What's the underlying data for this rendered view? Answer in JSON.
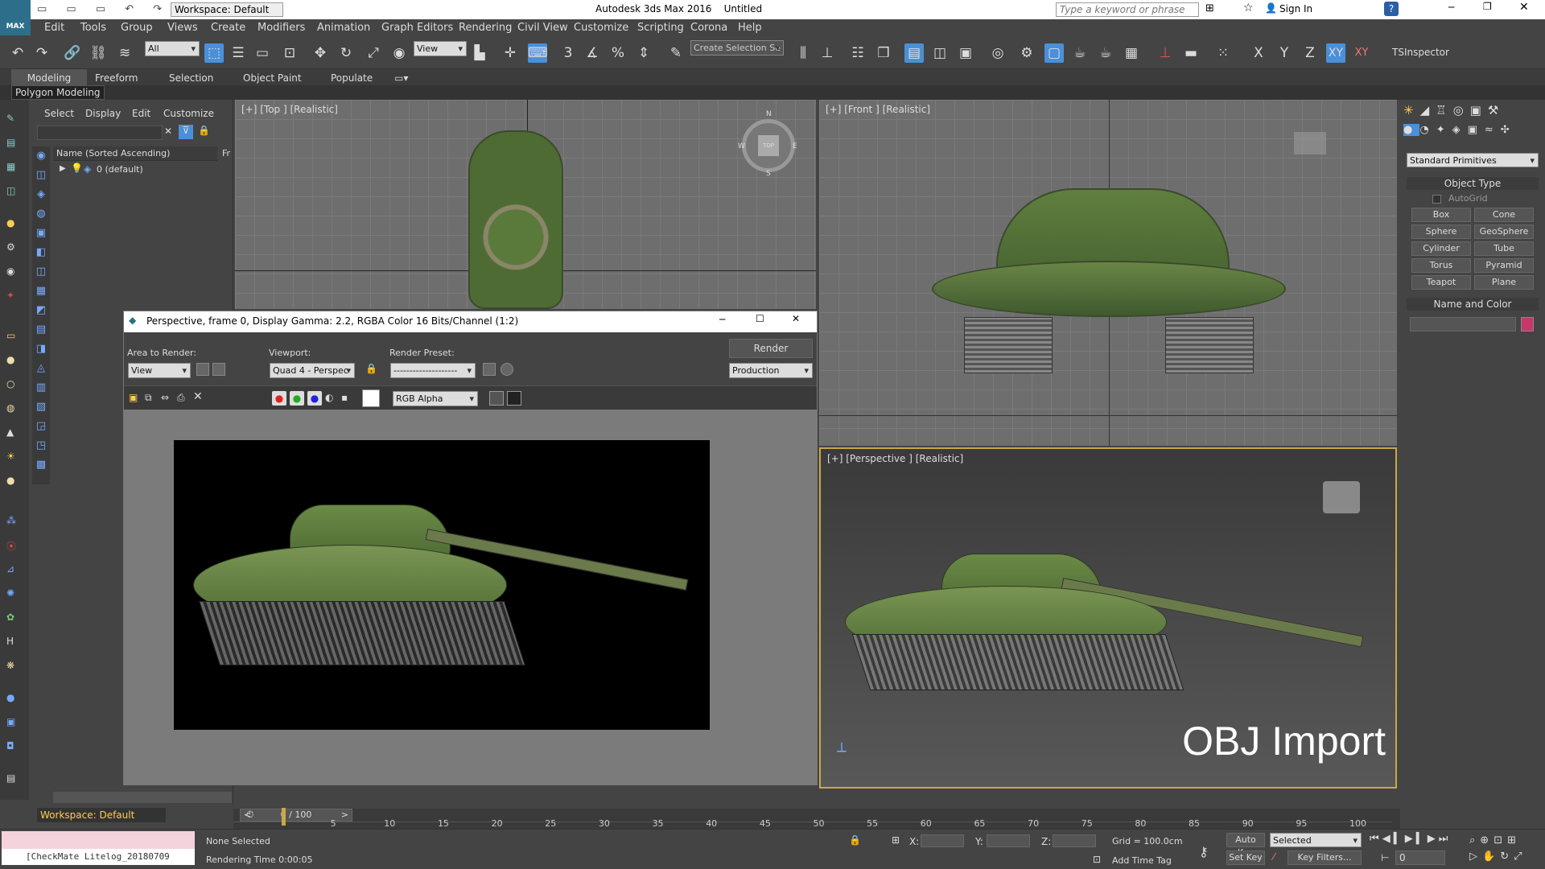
{
  "app": {
    "title": "Autodesk 3ds Max 2016",
    "doc": "Untitled",
    "logo": "MAX"
  },
  "titlebar": {
    "workspace": "Workspace: Default",
    "search_placeholder": "Type a keyword or phrase",
    "sign_in": "Sign In"
  },
  "menu": [
    "Edit",
    "Tools",
    "Group",
    "Views",
    "Create",
    "Modifiers",
    "Animation",
    "Graph Editors",
    "Rendering",
    "Civil View",
    "Customize",
    "Scripting",
    "Corona",
    "Help"
  ],
  "toolbar": {
    "selection_filter": "All",
    "ref_coord": "View",
    "named_sel_placeholder": "Create Selection Se",
    "axis_x": "X",
    "axis_y": "Y",
    "axis_z": "Z",
    "axis_xy": "XY",
    "axis_xy2": "XY",
    "tsinspector": "TSInspector",
    "snap_label": "3"
  },
  "ribbon": {
    "tabs": [
      "Modeling",
      "Freeform",
      "Selection",
      "Object Paint",
      "Populate"
    ],
    "subtitle": "Polygon Modeling"
  },
  "scene_explorer": {
    "menus": [
      "Select",
      "Display",
      "Edit",
      "Customize"
    ],
    "column": "Name (Sorted Ascending)",
    "column2": "Fr",
    "layer": "0 (default)",
    "workspace": "Workspace: Default"
  },
  "viewports": {
    "top": "[+] [Top ] [Realistic]",
    "front": "[+] [Front ] [Realistic]",
    "perspective": "[+] [Perspective ] [Realistic]",
    "overlay_text": "OBJ Import",
    "compass": {
      "n": "N",
      "s": "S",
      "e": "E",
      "w": "W",
      "center": "TOP"
    }
  },
  "render_window": {
    "title": "Perspective, frame 0, Display Gamma: 2.2, RGBA Color 16 Bits/Channel (1:2)",
    "area_label": "Area to Render:",
    "area_value": "View",
    "viewport_label": "Viewport:",
    "viewport_value": "Quad 4 - Perspec",
    "preset_label": "Render Preset:",
    "preset_value": "--------------------",
    "render_button": "Render",
    "mode_value": "Production",
    "channel_value": "RGB Alpha"
  },
  "command_panel": {
    "category": "Standard Primitives",
    "object_type_header": "Object Type",
    "autogrid": "AutoGrid",
    "buttons": [
      "Box",
      "Cone",
      "Sphere",
      "GeoSphere",
      "Cylinder",
      "Tube",
      "Torus",
      "Pyramid",
      "Teapot",
      "Plane"
    ],
    "name_color_header": "Name and Color",
    "color": "#c8366a"
  },
  "timeline": {
    "frame_counter": "0 / 100",
    "ticks": [
      "5",
      "10",
      "15",
      "20",
      "25",
      "30",
      "35",
      "40",
      "45",
      "50",
      "55",
      "60",
      "65",
      "70",
      "75",
      "80",
      "85",
      "90",
      "95",
      "100"
    ]
  },
  "status": {
    "maxscript": "[CheckMate Litelog_20180709",
    "selection": "None Selected",
    "render_time": "Rendering Time  0:00:05",
    "x_label": "X:",
    "y_label": "Y:",
    "z_label": "Z:",
    "grid": "Grid = 100.0cm",
    "add_time_tag": "Add Time Tag",
    "auto_key": "Auto Key",
    "set_key": "Set Key",
    "key_mode": "Selected",
    "key_filters": "Key Filters...",
    "frame": "0"
  },
  "colors": {
    "accent": "#4a90d9",
    "selected_frame": "#c8a84a",
    "tank_green": "#4e6b34"
  }
}
